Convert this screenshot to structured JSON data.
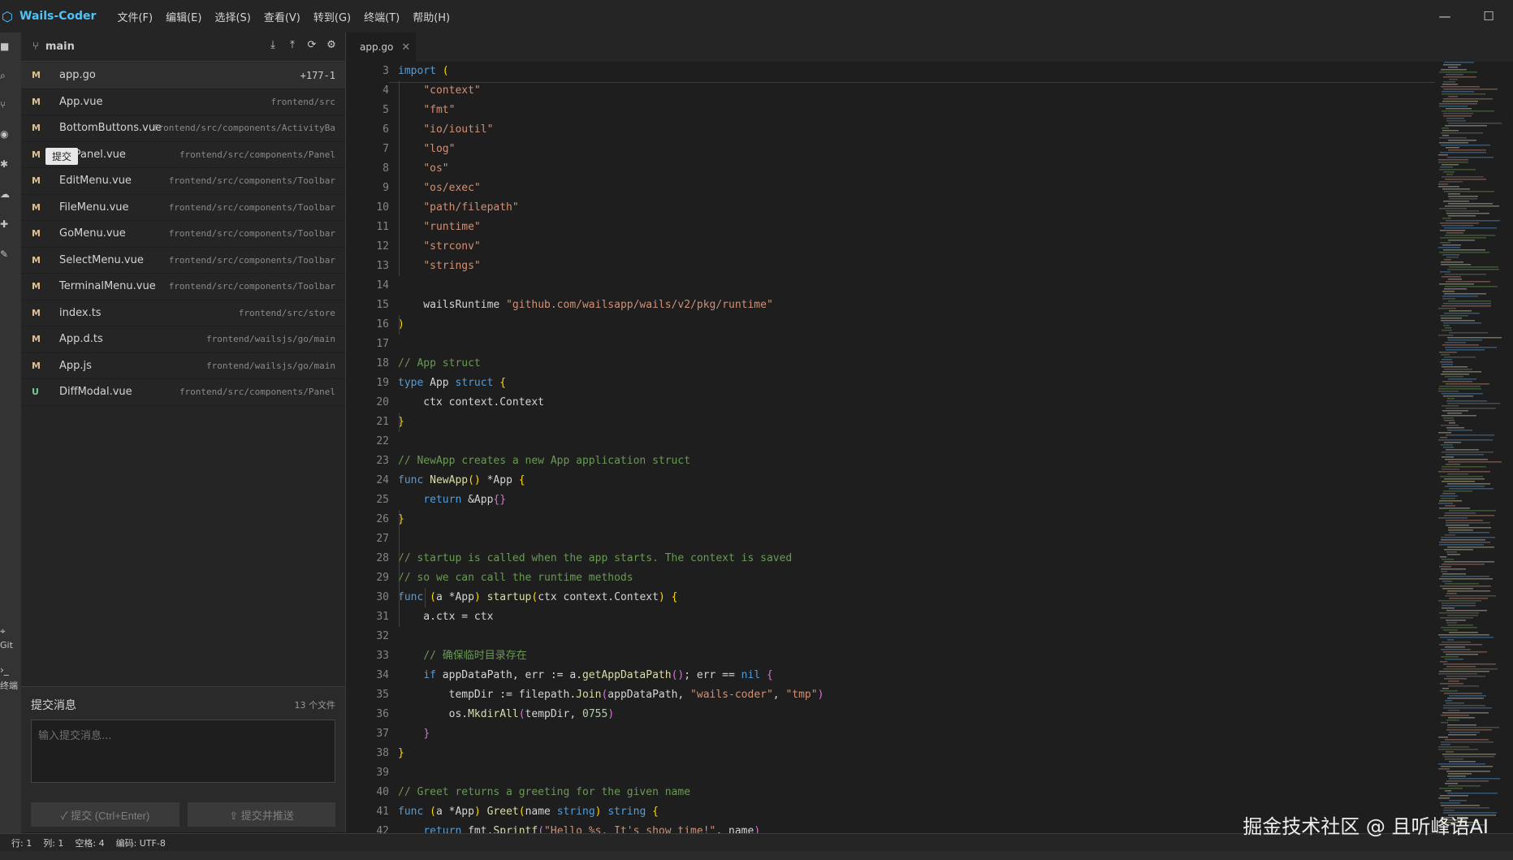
{
  "app": {
    "name": "Wails-Coder",
    "logo_icon": "hexagon-logo-icon",
    "accent": "#4fc3f7"
  },
  "menu": [
    "文件(F)",
    "编辑(E)",
    "选择(S)",
    "查看(V)",
    "转到(G)",
    "终端(T)",
    "帮助(H)"
  ],
  "window_controls": {
    "minimize": "—",
    "maximize": "☐"
  },
  "activity_bar": {
    "icons": [
      "explorer-icon",
      "search-icon",
      "source-control-icon",
      "eye-icon",
      "bug-icon",
      "cloud-icon",
      "extensions-icon",
      "tools-icon",
      "git-icon",
      "terminal-icon"
    ],
    "git_label": "Git",
    "terminal_label": "终端"
  },
  "git_panel": {
    "branch": "main",
    "actions": [
      "pull-icon",
      "push-icon",
      "refresh-icon",
      "settings-icon"
    ],
    "tooltip": "提交",
    "files": [
      {
        "status": "M",
        "name": "app.go",
        "path": "",
        "stat": "+177-1"
      },
      {
        "status": "M",
        "name": "App.vue",
        "path": "frontend/src",
        "stat": ""
      },
      {
        "status": "M",
        "name": "BottomButtons.vue",
        "path": "frontend/src/components/ActivityBa",
        "stat": ""
      },
      {
        "status": "M",
        "name": "GitPanel.vue",
        "path": "frontend/src/components/Panel",
        "stat": ""
      },
      {
        "status": "M",
        "name": "EditMenu.vue",
        "path": "frontend/src/components/Toolbar",
        "stat": ""
      },
      {
        "status": "M",
        "name": "FileMenu.vue",
        "path": "frontend/src/components/Toolbar",
        "stat": ""
      },
      {
        "status": "M",
        "name": "GoMenu.vue",
        "path": "frontend/src/components/Toolbar",
        "stat": ""
      },
      {
        "status": "M",
        "name": "SelectMenu.vue",
        "path": "frontend/src/components/Toolbar",
        "stat": ""
      },
      {
        "status": "M",
        "name": "TerminalMenu.vue",
        "path": "frontend/src/components/Toolbar",
        "stat": ""
      },
      {
        "status": "M",
        "name": "index.ts",
        "path": "frontend/src/store",
        "stat": ""
      },
      {
        "status": "M",
        "name": "App.d.ts",
        "path": "frontend/wailsjs/go/main",
        "stat": ""
      },
      {
        "status": "M",
        "name": "App.js",
        "path": "frontend/wailsjs/go/main",
        "stat": ""
      },
      {
        "status": "U",
        "name": "DiffModal.vue",
        "path": "frontend/src/components/Panel",
        "stat": ""
      }
    ],
    "commit": {
      "title": "提交消息",
      "count": "13 个文件",
      "placeholder": "输入提交消息...",
      "commit_label": "✓ 提交 (Ctrl+Enter)",
      "push_label": "⇪ 提交并推送"
    }
  },
  "editor": {
    "tab": "app.go",
    "lines": [
      {
        "n": 3,
        "html": "<span class=\"kw\">import</span> <span class=\"pb\">(</span>"
      },
      {
        "n": 4,
        "html": "    <span class=\"str\">\"context\"</span>"
      },
      {
        "n": 5,
        "html": "    <span class=\"str\">\"fmt\"</span>"
      },
      {
        "n": 6,
        "html": "    <span class=\"str\">\"io/ioutil\"</span>"
      },
      {
        "n": 7,
        "html": "    <span class=\"str\">\"log\"</span>"
      },
      {
        "n": 8,
        "html": "    <span class=\"str\">\"os\"</span>"
      },
      {
        "n": 9,
        "html": "    <span class=\"str\">\"os/exec\"</span>"
      },
      {
        "n": 10,
        "html": "    <span class=\"str\">\"path/filepath\"</span>"
      },
      {
        "n": 11,
        "html": "    <span class=\"str\">\"runtime\"</span>"
      },
      {
        "n": 12,
        "html": "    <span class=\"str\">\"strconv\"</span>"
      },
      {
        "n": 13,
        "html": "    <span class=\"str\">\"strings\"</span>"
      },
      {
        "n": 14,
        "html": ""
      },
      {
        "n": 15,
        "html": "    wailsRuntime <span class=\"str\">\"github.com/wailsapp/wails/v2/pkg/runtime\"</span>"
      },
      {
        "n": 16,
        "html": "<span class=\"pb\">)</span>"
      },
      {
        "n": 17,
        "html": ""
      },
      {
        "n": 18,
        "html": "<span class=\"cm\">// App struct</span>"
      },
      {
        "n": 19,
        "html": "<span class=\"kw\">type</span> App <span class=\"kw\">struct</span> <span class=\"pb\">{</span>"
      },
      {
        "n": 20,
        "html": "    ctx context.Context"
      },
      {
        "n": 21,
        "html": "<span class=\"pb\">}</span>"
      },
      {
        "n": 22,
        "html": ""
      },
      {
        "n": 23,
        "html": "<span class=\"cm\">// NewApp creates a new App application struct</span>"
      },
      {
        "n": 24,
        "html": "<span class=\"kw\">func</span> <span class=\"fn\">NewApp</span><span class=\"pb\">()</span> *App <span class=\"pb\">{</span>"
      },
      {
        "n": 25,
        "html": "    <span class=\"kw\">return</span> &amp;App<span class=\"pp\">{}</span>"
      },
      {
        "n": 26,
        "html": "<span class=\"pb\">}</span>"
      },
      {
        "n": 27,
        "html": ""
      },
      {
        "n": 28,
        "html": "<span class=\"cm\">// startup is called when the app starts. The context is saved</span>"
      },
      {
        "n": 29,
        "html": "<span class=\"cm\">// so we can call the runtime methods</span>"
      },
      {
        "n": 30,
        "html": "<span class=\"kw\">func</span> <span class=\"pb\">(</span>a *App<span class=\"pb\">)</span> <span class=\"fn\">startup</span><span class=\"pb\">(</span>ctx context.Context<span class=\"pb\">)</span> <span class=\"pb\">{</span>"
      },
      {
        "n": 31,
        "html": "    a.ctx = ctx"
      },
      {
        "n": 32,
        "html": ""
      },
      {
        "n": 33,
        "html": "    <span class=\"cm\">// 确保临时目录存在</span>"
      },
      {
        "n": 34,
        "html": "    <span class=\"kw\">if</span> appDataPath, err := a.<span class=\"fn\">getAppDataPath</span><span class=\"pp\">()</span>; err == <span class=\"kw\">nil</span> <span class=\"pp\">{</span>"
      },
      {
        "n": 35,
        "html": "        tempDir := filepath.<span class=\"fn\">Join</span><span class=\"pp\">(</span>appDataPath, <span class=\"str\">\"wails-coder\"</span>, <span class=\"str\">\"tmp\"</span><span class=\"pp\">)</span>"
      },
      {
        "n": 36,
        "html": "        os.<span class=\"fn\">MkdirAll</span><span class=\"pp\">(</span>tempDir, <span class=\"num\">0755</span><span class=\"pp\">)</span>"
      },
      {
        "n": 37,
        "html": "    <span class=\"pp\">}</span>"
      },
      {
        "n": 38,
        "html": "<span class=\"pb\">}</span>"
      },
      {
        "n": 39,
        "html": ""
      },
      {
        "n": 40,
        "html": "<span class=\"cm\">// Greet returns a greeting for the given name</span>"
      },
      {
        "n": 41,
        "html": "<span class=\"kw\">func</span> <span class=\"pb\">(</span>a *App<span class=\"pb\">)</span> <span class=\"fn\">Greet</span><span class=\"pb\">(</span>name <span class=\"kw\">string</span><span class=\"pb\">)</span> <span class=\"kw\">string</span> <span class=\"pb\">{</span>"
      },
      {
        "n": 42,
        "html": "    <span class=\"kw\">return</span> fmt.<span class=\"fn\">Sprintf</span><span class=\"pp\">(</span><span class=\"str\">\"Hello %s, It's show time!\"</span>, name<span class=\"pp\">)</span>"
      }
    ]
  },
  "status_bar": [
    "行: 1",
    "列: 1",
    "空格: 4",
    "编码: UTF-8"
  ],
  "watermark": "掘金技术社区 @ 且听峰语AI"
}
